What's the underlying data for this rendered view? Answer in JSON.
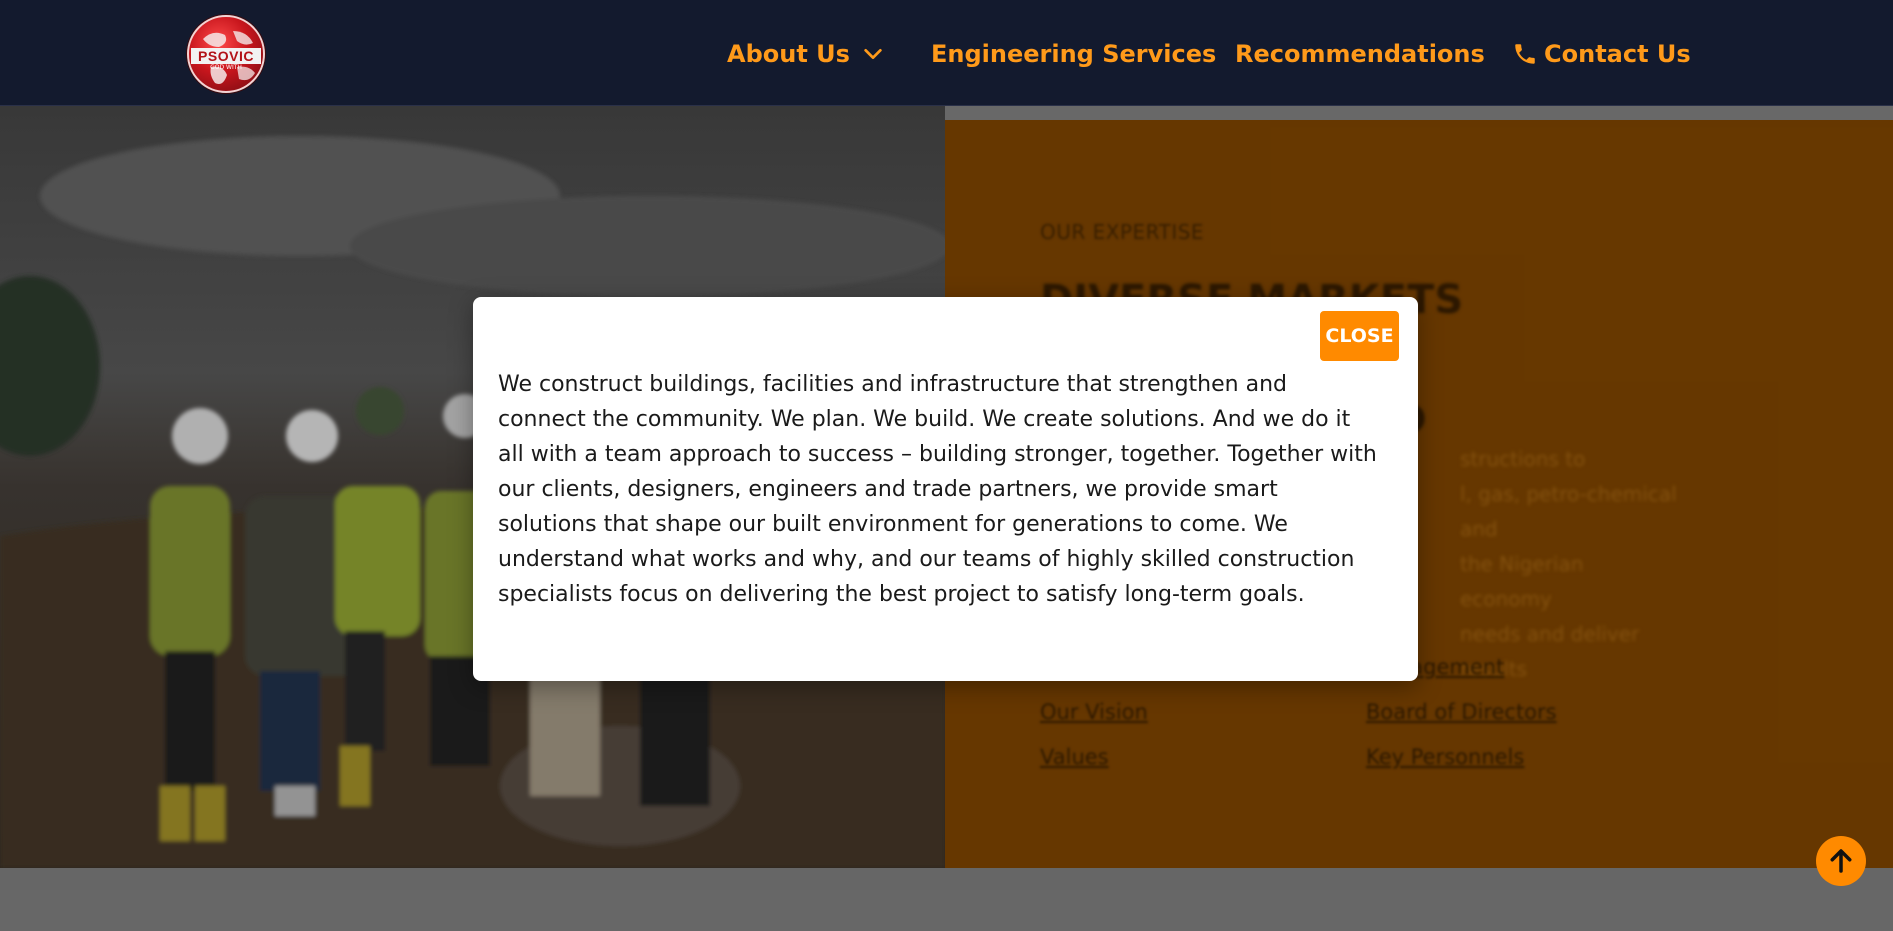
{
  "header": {
    "logo_text": "PSOVIC",
    "logo_subtext": "GOD WITH",
    "nav": [
      {
        "label": "About Us",
        "icon": "chevron-down-icon"
      },
      {
        "label": "Engineering Services"
      },
      {
        "label": "Recommendations"
      },
      {
        "label": "Contact Us",
        "icon": "phone-icon"
      }
    ]
  },
  "expertise": {
    "eyebrow": "OUR EXPERTISE",
    "title": "DIVERSE MARKETS MAKE",
    "title_line2": "ND",
    "body": [
      "structions to",
      "l, gas, petro-chemical and",
      "the Nigerian economy",
      "needs and deliver results"
    ],
    "links_left": [
      "Our Vision",
      "Values"
    ],
    "links_right": [
      "Management",
      "Board of Directors",
      "Key Personnels"
    ]
  },
  "modal": {
    "close_label": "CLOSE",
    "text": "We construct buildings, facilities and infrastructure that strengthen and connect the community. We plan. We build. We create solutions. And we do it all with a team approach to success – building stronger, together. Together with our clients, designers, engineers and trade partners, we provide smart solutions that shape our built environment for generations to come. We understand what works and why, and our teams of highly skilled construction specialists focus on delivering the best project to satisfy long-term goals."
  },
  "colors": {
    "header_bg": "#131a2e",
    "accent": "#ff8a00",
    "nav_text": "#ff9a1a",
    "expertise_bg_dimmed": "#6b3a00"
  },
  "back_to_top_icon": "arrow-up-icon"
}
